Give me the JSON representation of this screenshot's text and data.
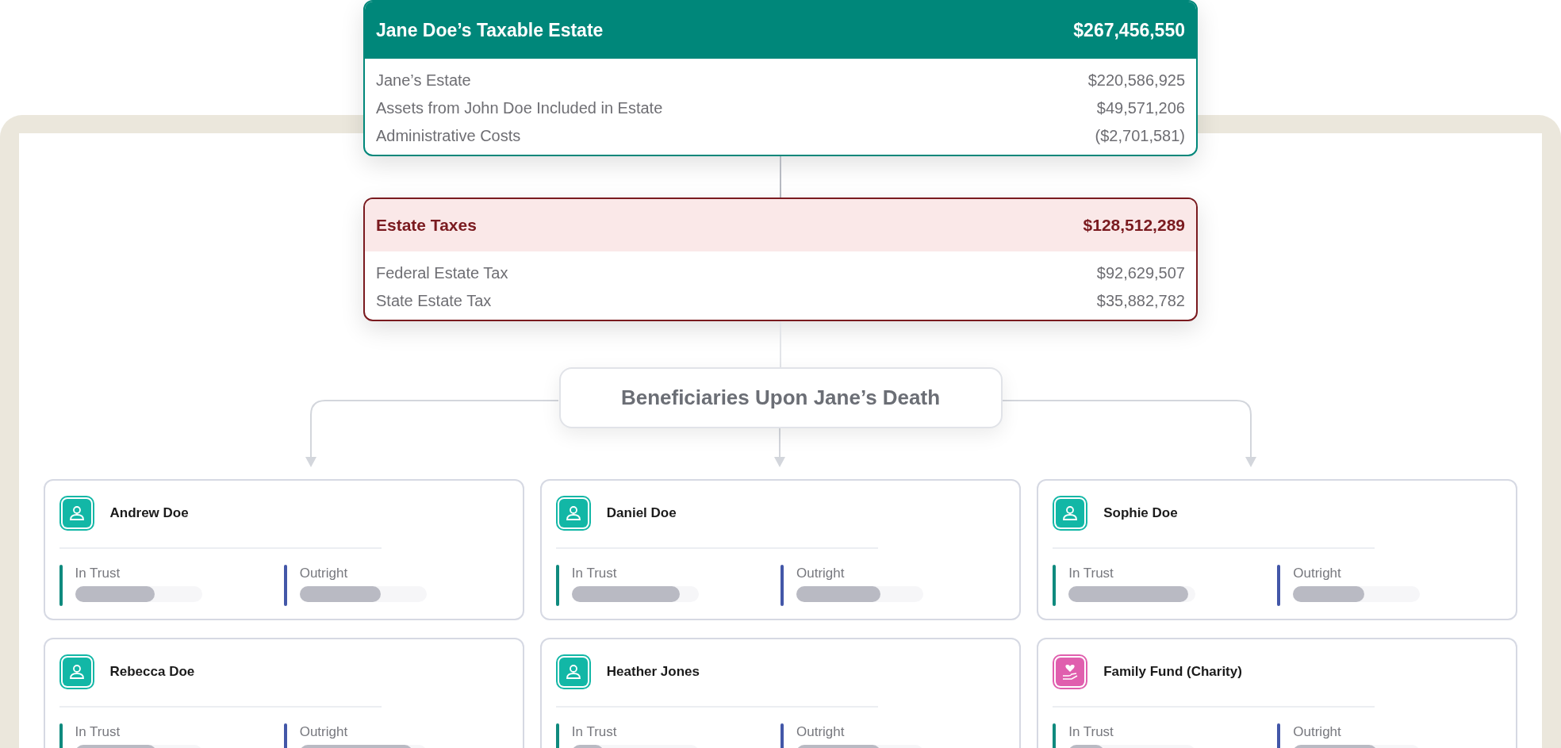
{
  "taxable_estate": {
    "title": "Jane Doe’s Taxable Estate",
    "total": "$267,456,550",
    "rows": [
      {
        "label": "Jane’s Estate",
        "amount": "$220,586,925"
      },
      {
        "label": "Assets from John Doe Included in Estate",
        "amount": "$49,571,206"
      },
      {
        "label": "Administrative Costs",
        "amount": "($2,701,581)"
      }
    ]
  },
  "estate_taxes": {
    "title": "Estate Taxes",
    "total": "$128,512,289",
    "rows": [
      {
        "label": "Federal Estate Tax",
        "amount": "$92,629,507"
      },
      {
        "label": "State Estate Tax",
        "amount": "$35,882,782"
      }
    ]
  },
  "beneficiaries_heading": "Beneficiaries Upon Jane’s Death",
  "beneficiaries": [
    {
      "name": "Andrew Doe",
      "kind": "person",
      "sections": [
        {
          "label": "In Trust",
          "kind": "trust",
          "level": 0.63
        },
        {
          "label": "Outright",
          "kind": "outright",
          "level": 0.64
        }
      ]
    },
    {
      "name": "Daniel Doe",
      "kind": "person",
      "sections": [
        {
          "label": "In Trust",
          "kind": "trust",
          "level": 0.85
        },
        {
          "label": "Outright",
          "kind": "outright",
          "level": 0.66
        }
      ]
    },
    {
      "name": "Sophie Doe",
      "kind": "person",
      "sections": [
        {
          "label": "In Trust",
          "kind": "trust",
          "level": 0.94
        },
        {
          "label": "Outright",
          "kind": "outright",
          "level": 0.56
        }
      ]
    },
    {
      "name": "Rebecca Doe",
      "kind": "person",
      "sections": [
        {
          "label": "In Trust",
          "kind": "trust",
          "level": 0.64
        },
        {
          "label": "Outright",
          "kind": "outright",
          "level": 0.89
        }
      ]
    },
    {
      "name": "Heather Jones",
      "kind": "person",
      "sections": [
        {
          "label": "In Trust",
          "kind": "trust",
          "level": 0.25
        },
        {
          "label": "Outright",
          "kind": "outright",
          "level": 0.66
        }
      ]
    },
    {
      "name": "Family Fund (Charity)",
      "kind": "charity",
      "sections": [
        {
          "label": "In Trust",
          "kind": "trust",
          "level": 0.28
        },
        {
          "label": "Outright",
          "kind": "outright",
          "level": 0.66
        }
      ]
    }
  ]
}
